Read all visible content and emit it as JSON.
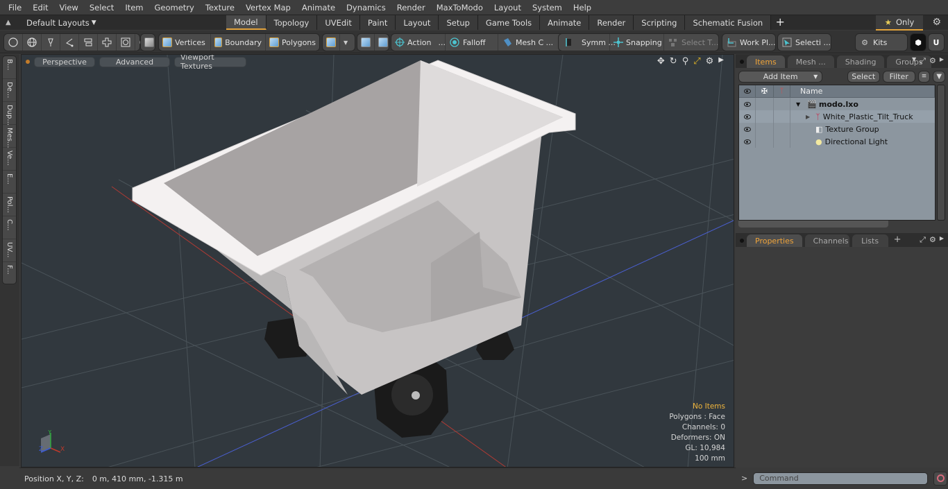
{
  "menu": [
    "File",
    "Edit",
    "View",
    "Select",
    "Item",
    "Geometry",
    "Texture",
    "Vertex Map",
    "Animate",
    "Dynamics",
    "Render",
    "MaxToModo",
    "Layout",
    "System",
    "Help"
  ],
  "layout_selector": "Default Layouts",
  "layout_tabs": [
    {
      "label": "Model",
      "active": true
    },
    {
      "label": "Topology",
      "active": false
    },
    {
      "label": "UVEdit",
      "active": false
    },
    {
      "label": "Paint",
      "active": false
    },
    {
      "label": "Layout",
      "active": false
    },
    {
      "label": "Setup",
      "active": false
    },
    {
      "label": "Game Tools",
      "active": false
    },
    {
      "label": "Animate",
      "active": false
    },
    {
      "label": "Render",
      "active": false
    },
    {
      "label": "Scripting",
      "active": false
    },
    {
      "label": "Schematic Fusion",
      "active": false
    }
  ],
  "only_toggle": "Only",
  "toolbar": {
    "vertices": "Vertices",
    "boundary": "Boundary",
    "polygons": "Polygons",
    "action": "Action",
    "action_more": "...",
    "falloff": "Falloff",
    "mesh_constraints": "Mesh C ...",
    "symmetry": "Symm ...",
    "snapping": "Snapping",
    "select_through": "Select T...",
    "work_plane": "Work Pl...",
    "selection_sets": "Selecti ...",
    "kits": "Kits"
  },
  "left_strip": [
    "B...",
    "De...",
    "Dup...",
    "Mes...",
    "Ve...",
    "E...",
    "Pol...",
    "C...",
    "UV...",
    "F..."
  ],
  "viewport": {
    "buttons": [
      "Perspective",
      "Advanced",
      "Viewport Textures"
    ],
    "stats": {
      "selection": "No Items",
      "polygons": "Polygons : Face",
      "channels": "Channels: 0",
      "deformers": "Deformers: ON",
      "gl": "GL: 10,984",
      "grid": "100 mm"
    },
    "axes": {
      "x": "X",
      "y": "Y",
      "z": "Z"
    }
  },
  "status": {
    "label": "Position X, Y, Z:",
    "value": "0 m, 410 mm, -1.315 m"
  },
  "items_panel": {
    "tabs": [
      {
        "label": "Items",
        "active": true
      },
      {
        "label": "Mesh ...",
        "active": false
      },
      {
        "label": "Shading",
        "active": false
      },
      {
        "label": "Groups",
        "active": false
      }
    ],
    "add_item": "Add Item",
    "select": "Select",
    "filter": "Filter",
    "column_name": "Name",
    "tree": [
      {
        "name": "modo.lxo",
        "depth": 0,
        "icon": "scene-icon",
        "bold": true
      },
      {
        "name": "White_Plastic_Tilt_Truck",
        "depth": 1,
        "icon": "mesh-locator-icon",
        "bold": false
      },
      {
        "name": "Texture Group",
        "depth": 1,
        "icon": "texture-group-icon",
        "bold": false
      },
      {
        "name": "Directional Light",
        "depth": 1,
        "icon": "light-icon",
        "bold": false
      }
    ]
  },
  "properties_panel": {
    "tabs": [
      {
        "label": "Properties",
        "active": true
      },
      {
        "label": "Channels",
        "active": false
      },
      {
        "label": "Lists",
        "active": false
      }
    ]
  },
  "command": {
    "prompt": ">",
    "placeholder": "Command"
  },
  "colors": {
    "accent": "#e2a23b",
    "stats_highlight": "#f0b53c",
    "axis_x": "#c0392b",
    "axis_y": "#2faa3c",
    "axis_z": "#3b5bd6"
  }
}
